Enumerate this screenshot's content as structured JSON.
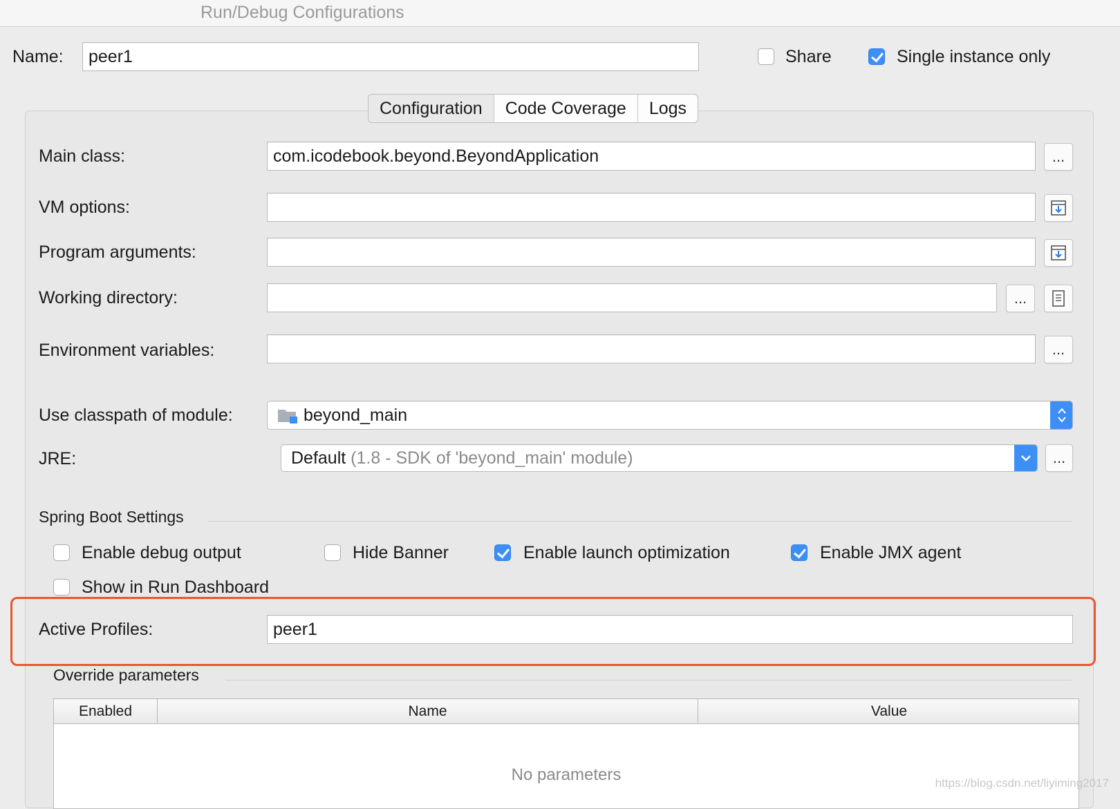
{
  "window": {
    "title": "Run/Debug Configurations"
  },
  "header": {
    "name_label": "Name:",
    "name_value": "peer1",
    "share_label": "Share",
    "share_checked": false,
    "single_instance_label": "Single instance only",
    "single_instance_checked": true
  },
  "tabs": [
    {
      "label": "Configuration",
      "selected": true
    },
    {
      "label": "Code Coverage",
      "selected": false
    },
    {
      "label": "Logs",
      "selected": false
    }
  ],
  "form": {
    "main_class_label": "Main class:",
    "main_class_value": "com.icodebook.beyond.BeyondApplication",
    "vm_options_label": "VM options:",
    "vm_options_value": "",
    "program_args_label": "Program arguments:",
    "program_args_value": "",
    "working_dir_label": "Working directory:",
    "working_dir_value": "",
    "env_vars_label": "Environment variables:",
    "env_vars_value": "",
    "classpath_label": "Use classpath of module:",
    "classpath_value": "beyond_main",
    "jre_label": "JRE:",
    "jre_value_main": "Default",
    "jre_value_detail": "(1.8 - SDK of 'beyond_main' module)",
    "browse_label": "..."
  },
  "spring_boot": {
    "section_title": "Spring Boot Settings",
    "options": [
      {
        "label": "Enable debug output",
        "checked": false
      },
      {
        "label": "Hide Banner",
        "checked": false
      },
      {
        "label": "Enable launch optimization",
        "checked": true
      },
      {
        "label": "Enable JMX agent",
        "checked": true
      },
      {
        "label": "Show in Run Dashboard",
        "checked": false
      }
    ],
    "active_profiles_label": "Active Profiles:",
    "active_profiles_value": "peer1"
  },
  "override": {
    "section_title": "Override parameters",
    "columns": [
      "Enabled",
      "Name",
      "Value"
    ],
    "empty_text": "No parameters"
  },
  "watermark": "https://blog.csdn.net/liyiming2017",
  "colors": {
    "accent": "#3d8ff5",
    "highlight": "#e8572e",
    "background": "#ececec"
  }
}
